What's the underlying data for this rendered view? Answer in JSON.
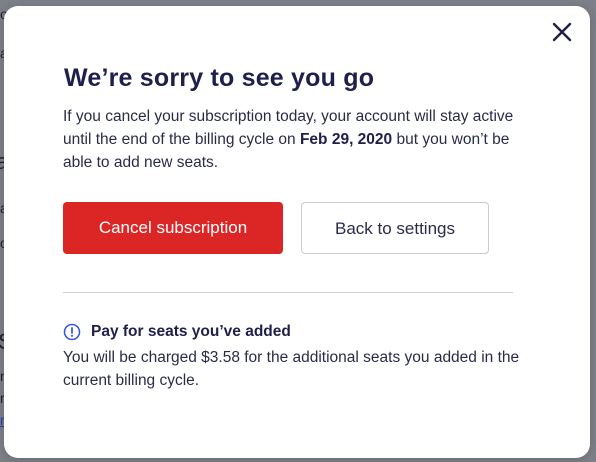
{
  "background": {
    "fragments": [
      "o",
      "a",
      "a",
      "a",
      "o",
      "S",
      "n",
      "r",
      "r"
    ]
  },
  "modal": {
    "close_icon": "close-icon",
    "title": "We’re sorry to see you go",
    "description_before": "If you cancel your subscription today, your account will stay active until the end of the billing cycle on ",
    "description_date": "Feb 29, 2020",
    "description_after": " but you won’t be able to add new seats.",
    "cancel_button": "Cancel subscription",
    "back_button": "Back to settings",
    "notice": {
      "icon": "info-icon",
      "title": "Pay for seats you’ve added",
      "body": "You will be charged $3.58 for the additional seats you added in the current billing cycle."
    }
  },
  "colors": {
    "primary_danger": "#dc2626",
    "heading": "#1e1f4b",
    "overlay": "#7f818a",
    "icon_accent": "#3b5bd9"
  }
}
